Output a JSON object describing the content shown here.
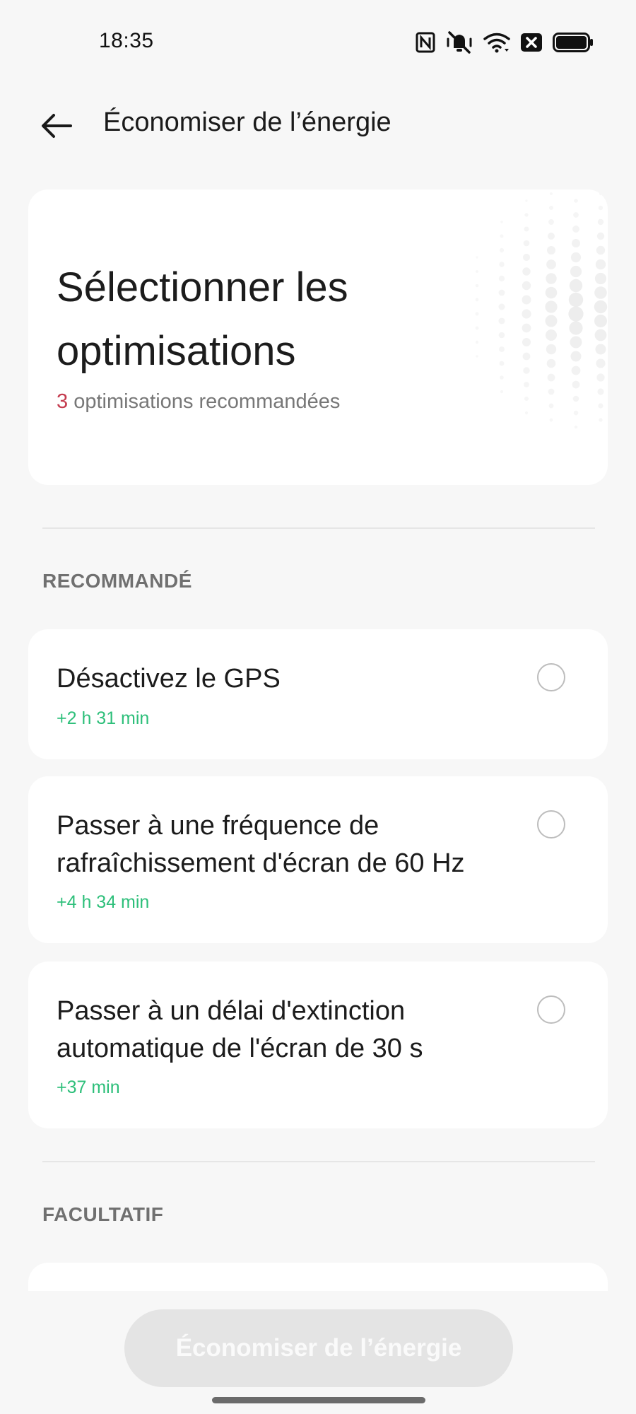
{
  "status_bar": {
    "time": "18:35",
    "icons": [
      "nfc-icon",
      "vibrate-mode-icon",
      "wifi-icon",
      "sim-disabled-icon",
      "battery-icon"
    ]
  },
  "header": {
    "back_icon": "arrow-left-icon",
    "title": "Économiser de l’énergie"
  },
  "hero": {
    "title": "Sélectionner les optimisations",
    "count": "3",
    "subtitle": " optimisations recommandées"
  },
  "sections": {
    "recommended_label": "RECOMMANDÉ",
    "optional_label": "FACULTATIF"
  },
  "options": [
    {
      "title": "Désactivez le GPS",
      "gain": "+2 h 31 min",
      "selected": false
    },
    {
      "title": "Passer à une fréquence de rafraîchissement d'écran de 60 Hz",
      "gain": "+4 h 34 min",
      "selected": false
    },
    {
      "title": "Passer à un délai d'extinction automatique de l'écran de 30 s",
      "gain": "+37 min",
      "selected": false
    }
  ],
  "primary_button": {
    "label": "Économiser de l’énergie",
    "enabled": false
  },
  "colors": {
    "background": "#f7f7f7",
    "card": "#ffffff",
    "gain_green": "#2dbf7a",
    "count_red": "#c43b4e",
    "button_disabled": "#e4e4e4"
  }
}
